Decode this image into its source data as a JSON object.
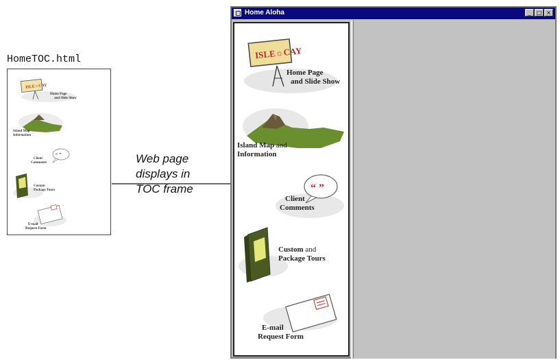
{
  "left_file": {
    "filename": "HomeTOC.html"
  },
  "annotation": {
    "lines": [
      "Web page",
      "displays in",
      "TOC frame"
    ]
  },
  "window": {
    "title": "Home Aloha",
    "buttons": {
      "minimize": "_",
      "maximize": "□",
      "close": "×"
    }
  },
  "toc": {
    "logo_text": "ISLE☼CAY",
    "items": [
      {
        "id": "home",
        "line1": "Home Page",
        "line2": "and Slide Show",
        "icon": "billboard-icon"
      },
      {
        "id": "map",
        "line1": "Island Map",
        "line1b": "and",
        "line2": "Information",
        "icon": "island-map-icon"
      },
      {
        "id": "comments",
        "line1": "Client",
        "line2": "Comments",
        "bubble_text": "“ ”",
        "icon": "speech-bubble-icon"
      },
      {
        "id": "tours",
        "line1": "Custom",
        "line1b": "and",
        "line2": "Package Tours",
        "icon": "brochure-icon"
      },
      {
        "id": "email",
        "line1": "E-mail",
        "line2": "Request Form",
        "icon": "envelope-icon"
      }
    ]
  },
  "colors": {
    "titlebar": "#0a0a80",
    "content_frame": "#c2c2c2",
    "map_green": "#6a8f2e",
    "map_brown": "#6b5a3a",
    "bubble_red": "#c0282a"
  }
}
